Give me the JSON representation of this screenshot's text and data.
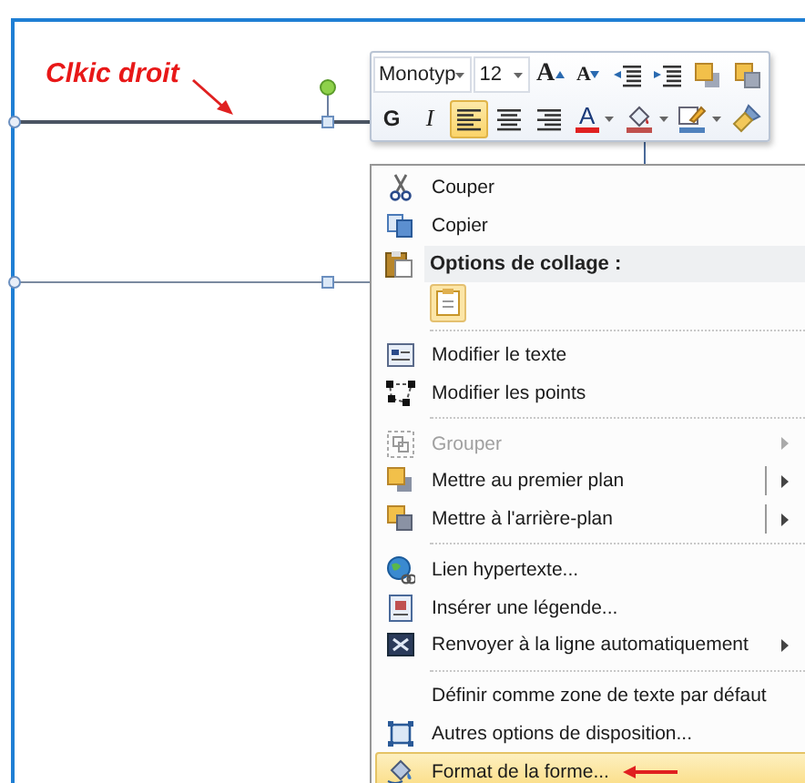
{
  "annotation": {
    "text": "Clkic droit"
  },
  "mini_toolbar": {
    "font_box": {
      "value": "Monotyp"
    },
    "size_box": {
      "value": "12"
    },
    "grow_font_button": {
      "label": "A"
    },
    "shrink_font_button": {
      "label": "A"
    },
    "bold_button": {
      "label": "G"
    },
    "italic_button": {
      "label": "I"
    },
    "align_buttons": [
      {
        "kind": "left",
        "selected": true
      },
      {
        "kind": "center",
        "selected": false
      },
      {
        "kind": "right",
        "selected": false
      }
    ],
    "font_color_button": {
      "label": "A"
    }
  },
  "context_menu": {
    "entries": [
      {
        "kind": "item",
        "label": "Couper",
        "disabled": false,
        "highlighted": false
      },
      {
        "kind": "item",
        "label": "Copier",
        "disabled": false,
        "highlighted": false
      },
      {
        "kind": "header",
        "label": "Options de collage :"
      },
      {
        "kind": "paste_options"
      },
      {
        "kind": "separator"
      },
      {
        "kind": "item",
        "label": "Modifier le texte",
        "disabled": false,
        "highlighted": false
      },
      {
        "kind": "item",
        "label": "Modifier les points",
        "disabled": false,
        "highlighted": false
      },
      {
        "kind": "separator"
      },
      {
        "kind": "item",
        "label": "Grouper",
        "disabled": true,
        "highlighted": false,
        "submenu": true,
        "split": false
      },
      {
        "kind": "item",
        "label": "Mettre au premier plan",
        "disabled": false,
        "highlighted": false,
        "submenu": true,
        "split": true
      },
      {
        "kind": "item",
        "label": "Mettre à l'arrière-plan",
        "disabled": false,
        "highlighted": false,
        "submenu": true,
        "split": true
      },
      {
        "kind": "separator"
      },
      {
        "kind": "item",
        "label": "Lien hypertexte...",
        "disabled": false,
        "highlighted": false
      },
      {
        "kind": "item",
        "label": "Insérer une légende...",
        "disabled": false,
        "highlighted": false
      },
      {
        "kind": "item",
        "label": "Renvoyer à la ligne automatiquement",
        "disabled": false,
        "highlighted": false,
        "submenu": true,
        "split": false
      },
      {
        "kind": "separator"
      },
      {
        "kind": "item",
        "label": "Définir comme zone de texte par défaut",
        "disabled": false,
        "highlighted": false
      },
      {
        "kind": "item",
        "label": "Autres options de disposition...",
        "disabled": false,
        "highlighted": false
      },
      {
        "kind": "item",
        "label": "Format de la forme...",
        "disabled": false,
        "highlighted": true
      }
    ]
  }
}
